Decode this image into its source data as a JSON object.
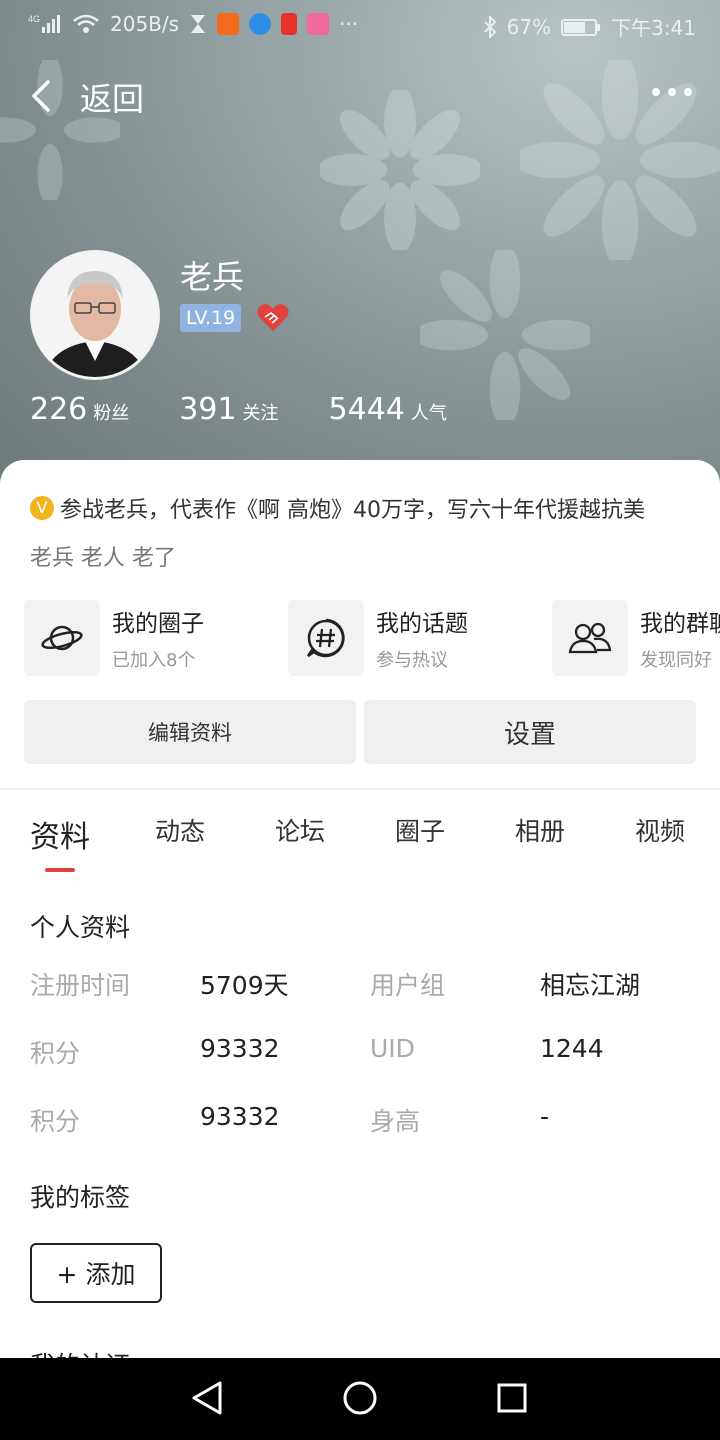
{
  "status_bar": {
    "network": "4G",
    "speed": "205B/s",
    "battery": "67%",
    "time": "下午3:41",
    "icons": [
      "signal-icon",
      "wifi-icon",
      "hourglass-icon",
      "app-icon",
      "browser-icon",
      "redpacket-icon",
      "bilibili-icon",
      "more-icon",
      "bluetooth-icon",
      "battery-icon"
    ]
  },
  "header": {
    "back_label": "返回",
    "more_icon": "more-dots-icon"
  },
  "profile": {
    "username": "老兵",
    "level": "LV.19",
    "stats": [
      {
        "num": "226",
        "label": "粉丝"
      },
      {
        "num": "391",
        "label": "关注"
      },
      {
        "num": "5444",
        "label": "人气"
      }
    ],
    "verified_mark": "V",
    "bio": "参战老兵，代表作《啊 高炮》40万字，写六十年代援越抗美",
    "tags_line": "老兵 老人 老了"
  },
  "quick_links": [
    {
      "title": "我的圈子",
      "sub": "已加入8个",
      "icon": "planet-icon"
    },
    {
      "title": "我的话题",
      "sub": "参与热议",
      "icon": "hashtag-icon"
    },
    {
      "title": "我的群聊",
      "sub": "发现同好",
      "icon": "group-icon"
    }
  ],
  "buttons": {
    "edit": "编辑资料",
    "settings": "设置"
  },
  "tabs": [
    "资料",
    "动态",
    "论坛",
    "圈子",
    "相册",
    "视频"
  ],
  "active_tab": "资料",
  "info": {
    "title": "个人资料",
    "rows": [
      {
        "k1": "注册时间",
        "v1": "5709天",
        "k2": "用户组",
        "v2": "相忘江湖"
      },
      {
        "k1": "积分",
        "v1": "93332",
        "k2": "UID",
        "v2": "1244"
      },
      {
        "k1": "积分",
        "v1": "93332",
        "k2": "身高",
        "v2": "-"
      }
    ]
  },
  "tags_section": {
    "title": "我的标签",
    "add_label": "+ 添加"
  },
  "next_section_title": "我的认证",
  "colors": {
    "accent": "#e0413a",
    "level_badge": "#8fb4e4",
    "verified": "#f2b41c"
  }
}
